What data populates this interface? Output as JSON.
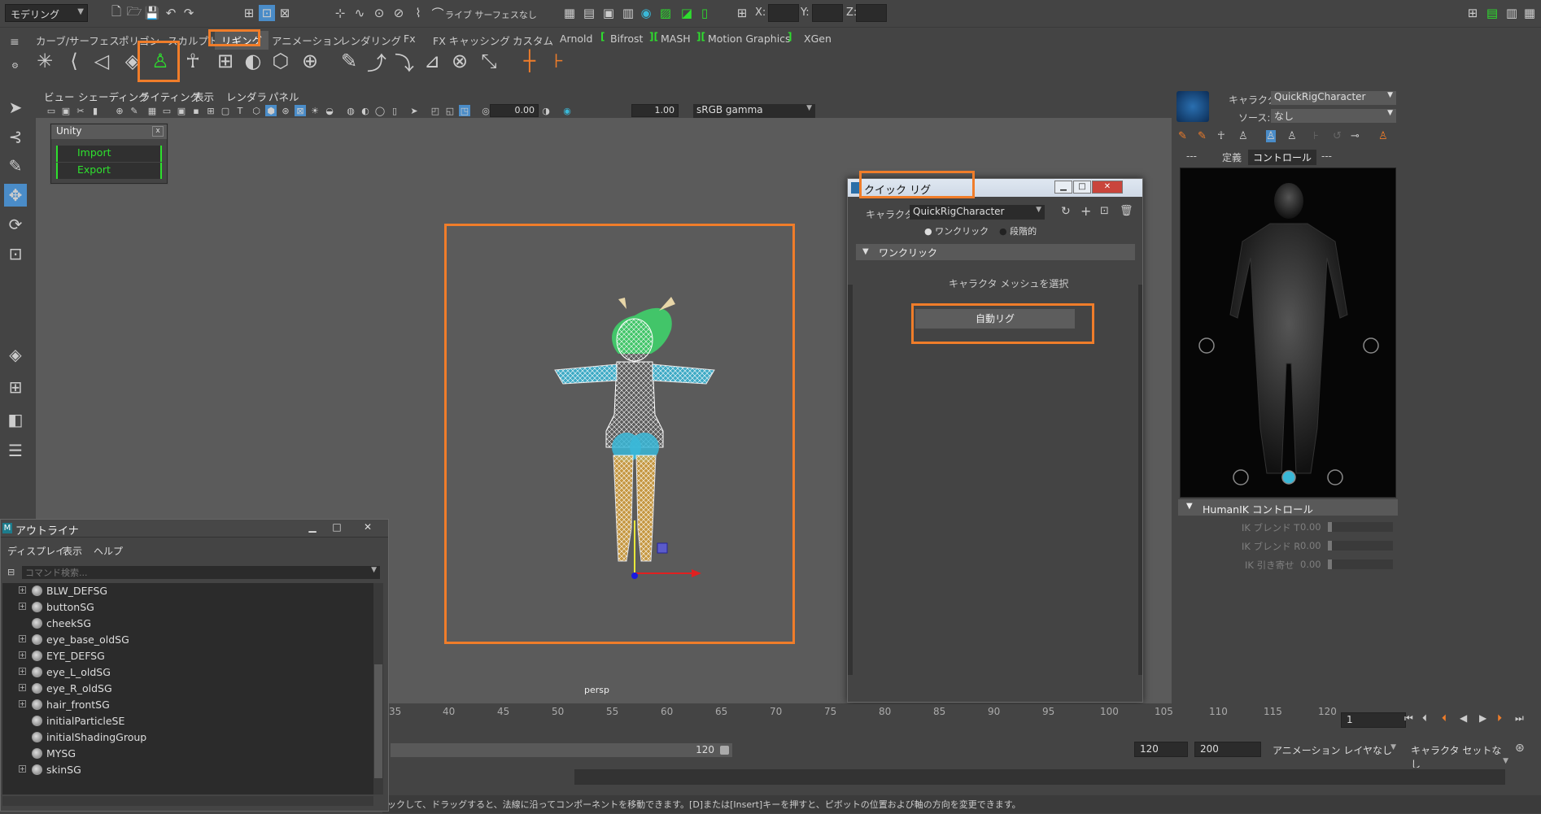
{
  "statusline": {
    "mode": "モデリング",
    "live_surface": "ライブ サーフェスなし",
    "x_label": "X:",
    "y_label": "Y:",
    "z_label": "Z:"
  },
  "shelf": {
    "tabs": [
      "カーブ/サーフェス",
      "ポリゴン",
      "スカルプト",
      "リギング",
      "アニメーション",
      "レンダリング",
      "Fx",
      "FX キャッシング",
      "カスタム",
      "Arnold",
      "Bifrost",
      "MASH",
      "Motion Graphics",
      "XGen"
    ],
    "active_tab": "リギング"
  },
  "viewport": {
    "menu": [
      "ビュー",
      "シェーディング",
      "ライティング",
      "表示",
      "レンダラ",
      "パネル"
    ],
    "exposure": "0.00",
    "gamma_val": "1.00",
    "color_space": "sRGB gamma",
    "camera": "persp"
  },
  "unity": {
    "title": "Unity",
    "close": "x",
    "import": "Import",
    "export": "Export"
  },
  "quickrig": {
    "title": "クイック リグ",
    "char_label": "キャラクタ:",
    "character": "QuickRigCharacter",
    "mode_one": "ワンクリック",
    "mode_step": "段階的",
    "section": "ワンクリック",
    "hint": "キャラクタ メッシュを選択",
    "auto_rig": "自動リグ",
    "min": "▁",
    "max": "□",
    "close": "✕"
  },
  "hik": {
    "char_label": "キャラクタ:",
    "character": "QuickRigCharacter",
    "source_label": "ソース:",
    "source": "なし",
    "tabs": [
      "---",
      "定義",
      "コントロール",
      "---"
    ],
    "active_tab": "コントロール",
    "controls": "HumanIK コントロール",
    "rows": [
      {
        "label": "IK ブレンド T",
        "val": "0.00"
      },
      {
        "label": "IK ブレンド R",
        "val": "0.00"
      },
      {
        "label": "IK 引き寄せ",
        "val": "0.00"
      }
    ]
  },
  "timeline": {
    "ticks": [
      "35",
      "40",
      "45",
      "50",
      "55",
      "60",
      "65",
      "70",
      "75",
      "80",
      "85",
      "90",
      "95",
      "100",
      "105",
      "110",
      "115",
      "120"
    ],
    "current": "1",
    "range_end": "120",
    "end": "120",
    "max": "200",
    "anim_layer": "アニメーション レイヤなし",
    "char_set": "キャラクタ セットなし"
  },
  "outliner": {
    "title": "アウトライナ",
    "menu": [
      "ディスプレイ",
      "表示",
      "ヘルプ"
    ],
    "search_placeholder": "コマンド検索...",
    "items": [
      {
        "name": "BLW_DEFSG",
        "expand": true
      },
      {
        "name": "buttonSG",
        "expand": true
      },
      {
        "name": "cheekSG",
        "expand": false
      },
      {
        "name": "eye_base_oldSG",
        "expand": true
      },
      {
        "name": "EYE_DEFSG",
        "expand": true
      },
      {
        "name": "eye_L_oldSG",
        "expand": true
      },
      {
        "name": "eye_R_oldSG",
        "expand": true
      },
      {
        "name": "hair_frontSG",
        "expand": true
      },
      {
        "name": "initialParticleSE",
        "expand": false
      },
      {
        "name": "initialShadingGroup",
        "expand": false
      },
      {
        "name": "MYSG",
        "expand": false
      },
      {
        "name": "skinSG",
        "expand": true
      }
    ]
  },
  "helpline": "ックして、ドラッグすると、法線に沿ってコンポーネントを移動できます。[D]または[Insert]キーを押すと、ピボットの位置および軸の方向を変更できます。",
  "colors": {
    "highlight": "#f07d2a",
    "bracket_green": "#2ede2e",
    "selected_blue": "#4a8cc8"
  }
}
